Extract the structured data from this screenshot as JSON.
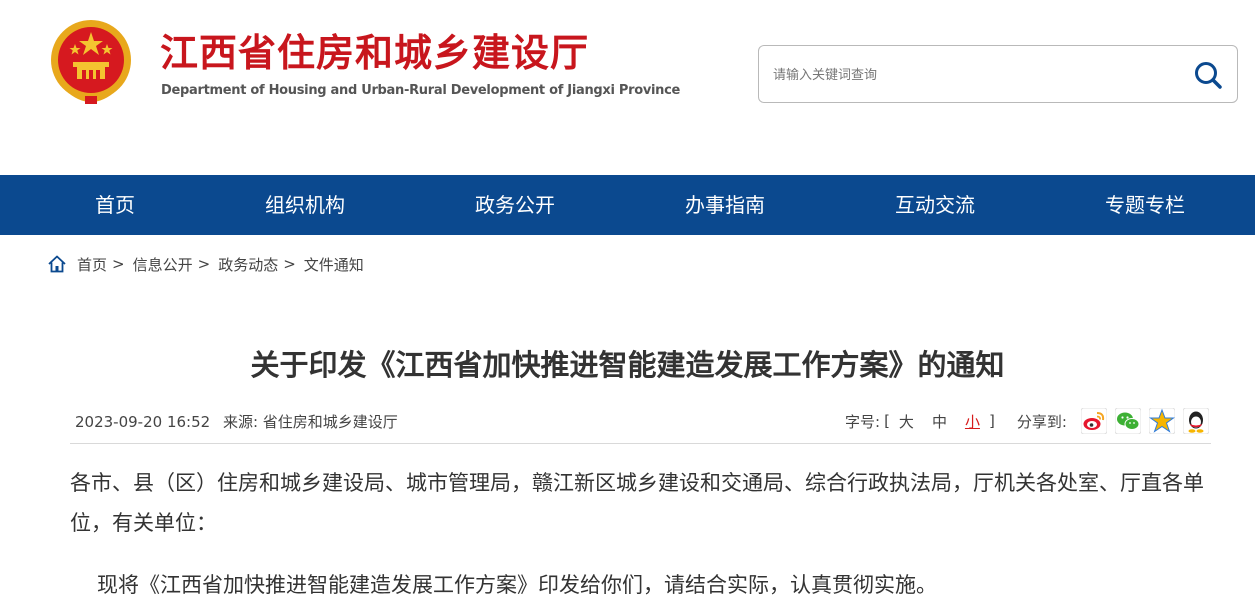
{
  "site": {
    "title": "江西省住房和城乡建设厅",
    "subtitle": "Department of Housing and Urban-Rural Development of Jiangxi Province"
  },
  "search": {
    "placeholder": "请输入关键词查询"
  },
  "nav": [
    "首页",
    "组织机构",
    "政务公开",
    "办事指南",
    "互动交流",
    "专题专栏"
  ],
  "breadcrumb": [
    "首页",
    "信息公开",
    "政务动态",
    "文件通知"
  ],
  "breadcrumb_sep": ">",
  "article": {
    "title": "关于印发《江西省加快推进智能建造发展工作方案》的通知",
    "datetime": "2023-09-20 16:52",
    "source_label": "来源:",
    "source": "省住房和城乡建设厅",
    "font_size_label": "字号:",
    "bracket_open": "[",
    "bracket_close": "]",
    "font_sizes": [
      "大",
      "中",
      "小"
    ],
    "share_label": "分享到:",
    "share_icons": [
      "weibo-icon",
      "wechat-icon",
      "qzone-icon",
      "qq-icon"
    ],
    "paragraph1": "各市、县（区）住房和城乡建设局、城市管理局，赣江新区城乡建设和交通局、综合行政执法局，厅机关各处室、厅直各单位，有关单位：",
    "paragraph2": "现将《江西省加快推进智能建造发展工作方案》印发给你们，请结合实际，认真贯彻实施。"
  },
  "colors": {
    "brand_red": "#c8161d",
    "nav_blue": "#0b498f",
    "active_size": "#d61b1b"
  }
}
